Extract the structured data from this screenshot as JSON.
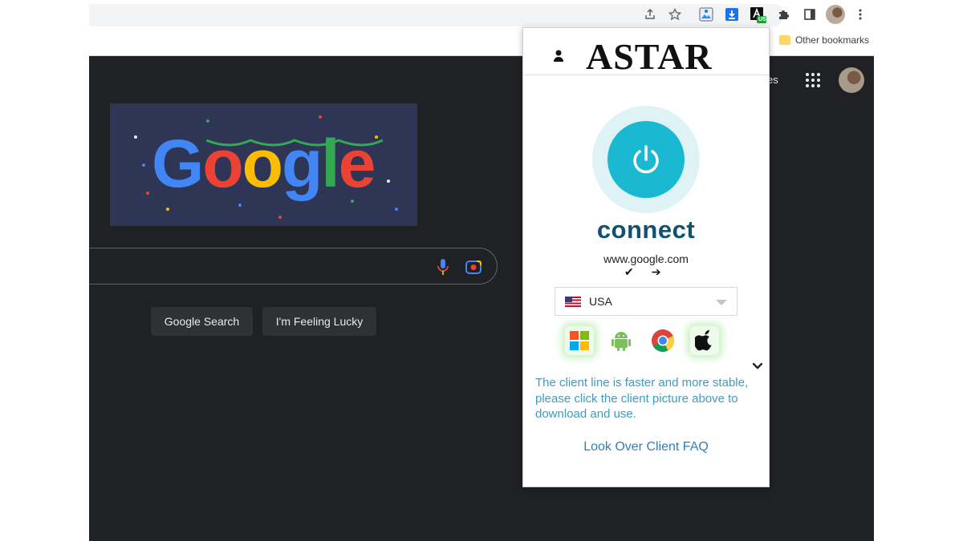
{
  "browser": {
    "bookmarks": {
      "other_label": "Other bookmarks"
    },
    "toolbar_icons": [
      "share-icon",
      "star-icon",
      "image-extension-icon",
      "download-extension-icon",
      "astar-extension-icon",
      "puzzle-icon",
      "side-panel-icon",
      "profile-avatar",
      "kebab-menu-icon"
    ],
    "extension_badge": "US"
  },
  "google": {
    "logo_text": "Google",
    "images_link_fragment": "es",
    "search_button": "Google Search",
    "lucky_button": "I'm Feeling Lucky"
  },
  "popup": {
    "brand": "ASTAR",
    "connect_label": "connect",
    "site": "www.google.com",
    "status": {
      "check": "✔",
      "arrow": "➔"
    },
    "country": "USA",
    "platforms": [
      "windows-icon",
      "android-icon",
      "chrome-icon",
      "apple-icon"
    ],
    "client_tip": "The client line is faster and more stable, please click the client picture above to download and use.",
    "faq_link": "Look Over Client FAQ"
  },
  "colors": {
    "power_button": "#1ab8d1",
    "power_halo": "#dff3f7",
    "connect_text": "#0f5272",
    "tip_text": "#3f9bbf",
    "faq_text": "#2f7fba",
    "page_bg": "#202124"
  }
}
